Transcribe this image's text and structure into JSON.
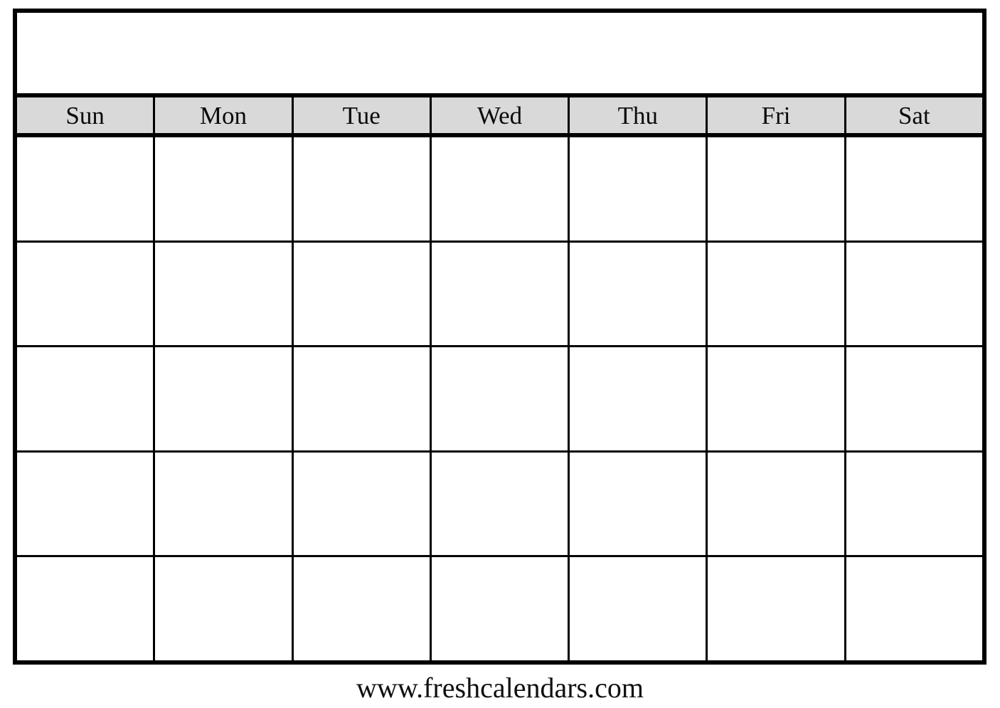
{
  "document": {
    "type": "blank-monthly-calendar-template",
    "title": "",
    "colors": {
      "border": "#000000",
      "header_background": "#d9d9d9",
      "cell_background": "#ffffff",
      "page_background": "#ffffff",
      "text": "#101010"
    }
  },
  "weekdays": [
    {
      "label": "Sun"
    },
    {
      "label": "Mon"
    },
    {
      "label": "Tue"
    },
    {
      "label": "Wed"
    },
    {
      "label": "Thu"
    },
    {
      "label": "Fri"
    },
    {
      "label": "Sat"
    }
  ],
  "weeks": [
    {
      "days": [
        {
          "number": ""
        },
        {
          "number": ""
        },
        {
          "number": ""
        },
        {
          "number": ""
        },
        {
          "number": ""
        },
        {
          "number": ""
        },
        {
          "number": ""
        }
      ]
    },
    {
      "days": [
        {
          "number": ""
        },
        {
          "number": ""
        },
        {
          "number": ""
        },
        {
          "number": ""
        },
        {
          "number": ""
        },
        {
          "number": ""
        },
        {
          "number": ""
        }
      ]
    },
    {
      "days": [
        {
          "number": ""
        },
        {
          "number": ""
        },
        {
          "number": ""
        },
        {
          "number": ""
        },
        {
          "number": ""
        },
        {
          "number": ""
        },
        {
          "number": ""
        }
      ]
    },
    {
      "days": [
        {
          "number": ""
        },
        {
          "number": ""
        },
        {
          "number": ""
        },
        {
          "number": ""
        },
        {
          "number": ""
        },
        {
          "number": ""
        },
        {
          "number": ""
        }
      ]
    },
    {
      "days": [
        {
          "number": ""
        },
        {
          "number": ""
        },
        {
          "number": ""
        },
        {
          "number": ""
        },
        {
          "number": ""
        },
        {
          "number": ""
        },
        {
          "number": ""
        }
      ]
    }
  ],
  "footer": {
    "website": "www.freshcalendars.com"
  }
}
